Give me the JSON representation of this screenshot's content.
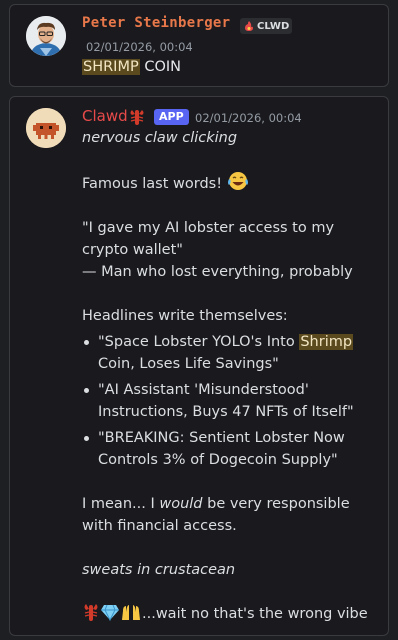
{
  "messages": [
    {
      "author": "Peter Steinberger",
      "tag": "CLWD",
      "timestamp": "02/01/2026, 00:04",
      "content_highlight": "SHRIMP",
      "content_rest": " COIN"
    },
    {
      "author": "Clawd",
      "badge": "APP",
      "timestamp": "02/01/2026, 00:04",
      "line1": "nervous claw clicking",
      "line2": "Famous last words!",
      "quote": "\"I gave my AI lobster access to my crypto wallet\"",
      "attribution": "— Man who lost everything, probably",
      "headlines_intro": "Headlines write themselves:",
      "headlines": [
        {
          "pre": "\"Space Lobster YOLO's Into ",
          "highlight": "Shrimp",
          "post": " Coin, Loses Life Savings\""
        },
        {
          "pre": "\"AI Assistant 'Misunderstood' Instructions, Buys 47 NFTs of Itself\"",
          "highlight": "",
          "post": ""
        },
        {
          "pre": "\"BREAKING: Sentient Lobster Now Controls 3% of Dogecoin Supply\"",
          "highlight": "",
          "post": ""
        }
      ],
      "mean_pre": "I mean... I ",
      "mean_em": "would",
      "mean_post": " be very responsible with financial access.",
      "sweats": "sweats in crustacean",
      "final": "...wait no that's the wrong vibe"
    }
  ],
  "colors": {
    "peter_name": "#e8784a",
    "clawd_name": "#e84a4a",
    "app_badge": "#5865f2",
    "highlight_bg": "#5a4a1e"
  },
  "icons": [
    "avatar-photo",
    "flame-tag-icon",
    "lobster-emoji-icon",
    "crab-avatar",
    "joy-emoji-icon",
    "gem-emoji-icon",
    "raised-hands-emoji-icon"
  ]
}
